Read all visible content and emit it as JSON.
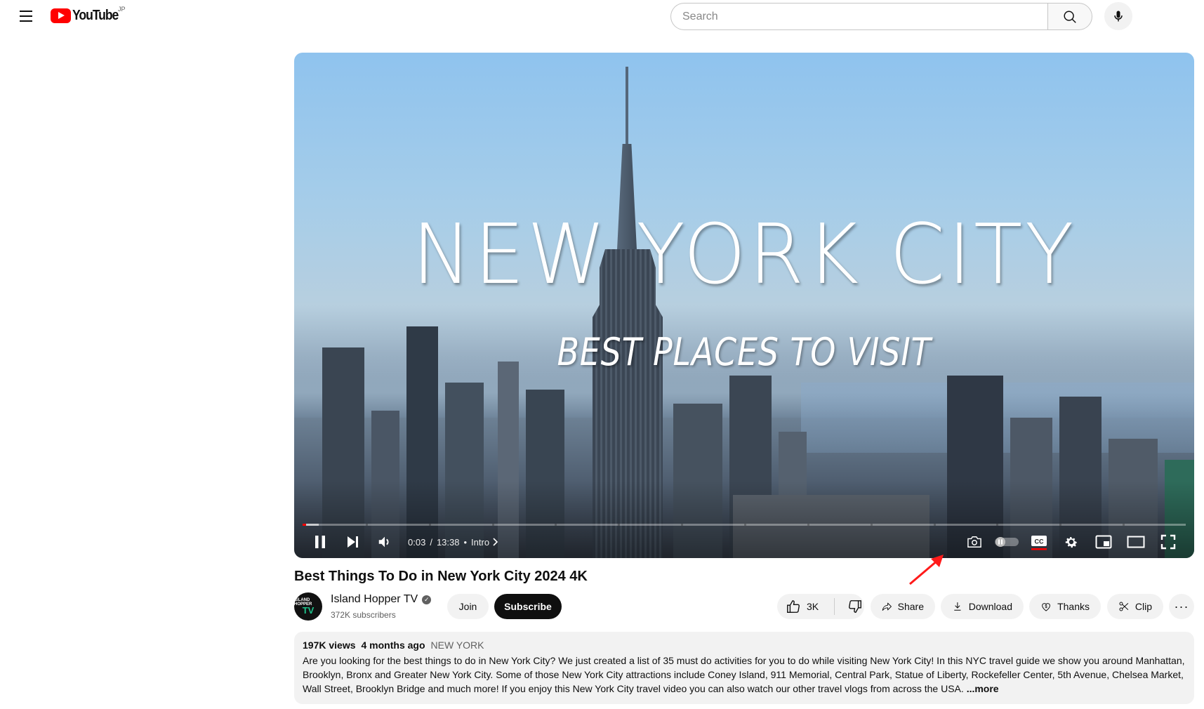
{
  "header": {
    "logo_text": "YouTube",
    "country_code": "JP",
    "search_placeholder": "Search",
    "search_value": ""
  },
  "video": {
    "overlay_title": "NEW YORK CITY",
    "overlay_subtitle": "BEST PLACES TO VISIT",
    "current_time": "0:03",
    "duration": "13:38",
    "time_separator": "/",
    "chapter_label": "Intro",
    "progress_played_fraction": 0.004,
    "progress_loaded_fraction": 0.018,
    "captions_enabled": true,
    "autoplay_enabled": false,
    "accent_color": "#ff0000"
  },
  "info": {
    "title": "Best Things To Do in New York City 2024 4K",
    "channel_name": "Island Hopper TV",
    "avatar_text_top": "ISLAND HOPPER",
    "avatar_text_bottom": "TV",
    "subscribers": "372K subscribers",
    "join_label": "Join",
    "subscribe_label": "Subscribe"
  },
  "actions": {
    "like_count": "3K",
    "share_label": "Share",
    "download_label": "Download",
    "thanks_label": "Thanks",
    "clip_label": "Clip",
    "more_label": "···"
  },
  "description": {
    "views": "197K views",
    "age": "4 months ago",
    "hashtag": "NEW YORK",
    "text": "Are you looking for the best things to do in New York City? We just created a list of 35 must do activities for you to do while visiting New York City! In this NYC travel guide we show you around Manhattan, Brooklyn, Bronx and Greater New York City. Some of those New York City attractions include Coney Island, 911 Memorial, Central Park, Statue of Liberty, Rockefeller Center, 5th Avenue, Chelsea Market, Wall Street, Brooklyn Bridge and much more!  If you enjoy this New York City travel video you can also watch our other travel vlogs from across the USA.",
    "more_label": "...more"
  }
}
